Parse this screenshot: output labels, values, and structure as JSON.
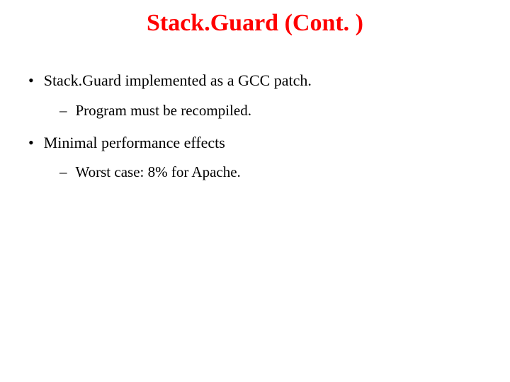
{
  "slide": {
    "title": "Stack.Guard (Cont. )",
    "bullets": [
      {
        "level": 1,
        "text": "Stack.Guard implemented as a GCC patch."
      },
      {
        "level": 2,
        "text": "Program must be recompiled."
      },
      {
        "level": 1,
        "text": "Minimal performance effects"
      },
      {
        "level": 2,
        "text": "Worst case:   8% for Apache."
      }
    ]
  }
}
